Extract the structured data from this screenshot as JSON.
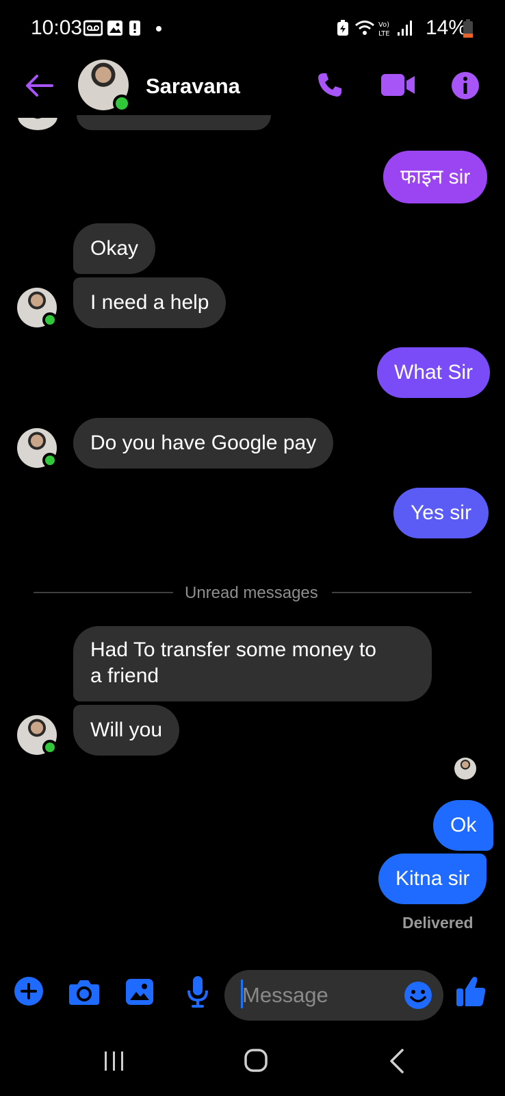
{
  "status_bar": {
    "time": "10:03",
    "battery": "14%"
  },
  "header": {
    "contact_name": "Saravana"
  },
  "messages": [
    {
      "text": "फाइन sir"
    },
    {
      "text": "Okay"
    },
    {
      "text": "I need a help"
    },
    {
      "text": "What Sir"
    },
    {
      "text": "Do you have Google pay"
    },
    {
      "text": "Yes sir"
    },
    {
      "text": "Had To transfer some money to a friend"
    },
    {
      "text": "Will you"
    },
    {
      "text": "Ok"
    },
    {
      "text": "Kitna sir"
    }
  ],
  "divider": {
    "label": "Unread messages"
  },
  "delivery_status": "Delivered",
  "composer": {
    "placeholder": "Message"
  },
  "colors": {
    "accent_purple": "#a855f7",
    "bubble_purple": "#9b44f2",
    "bubble_violet": "#7a4cf7",
    "bubble_indigo": "#5b5cf6",
    "bubble_blue": "#1f6bff",
    "incoming": "#303030",
    "online": "#31c73a"
  }
}
